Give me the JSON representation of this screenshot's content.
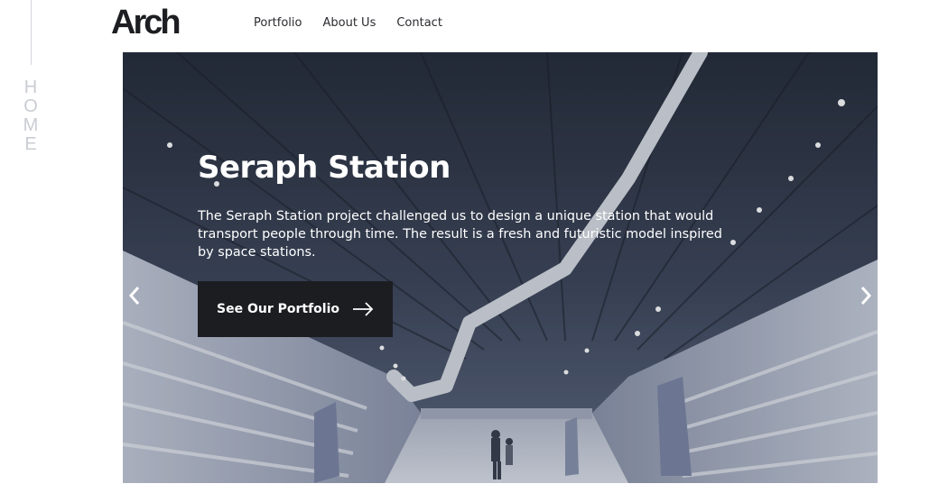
{
  "side": {
    "label": "HOME"
  },
  "header": {
    "logo": "Arch",
    "nav": [
      {
        "label": "Portfolio"
      },
      {
        "label": "About Us"
      },
      {
        "label": "Contact"
      }
    ]
  },
  "hero": {
    "title": "Seraph Station",
    "description": "The Seraph Station project challenged us to design a unique station that would transport people through time. The result is a fresh and futuristic model inspired by space stations.",
    "cta_label": "See Our Portfolio",
    "cta_icon": "arrow-right-icon",
    "prev_icon": "chevron-left-icon",
    "next_icon": "chevron-right-icon"
  }
}
